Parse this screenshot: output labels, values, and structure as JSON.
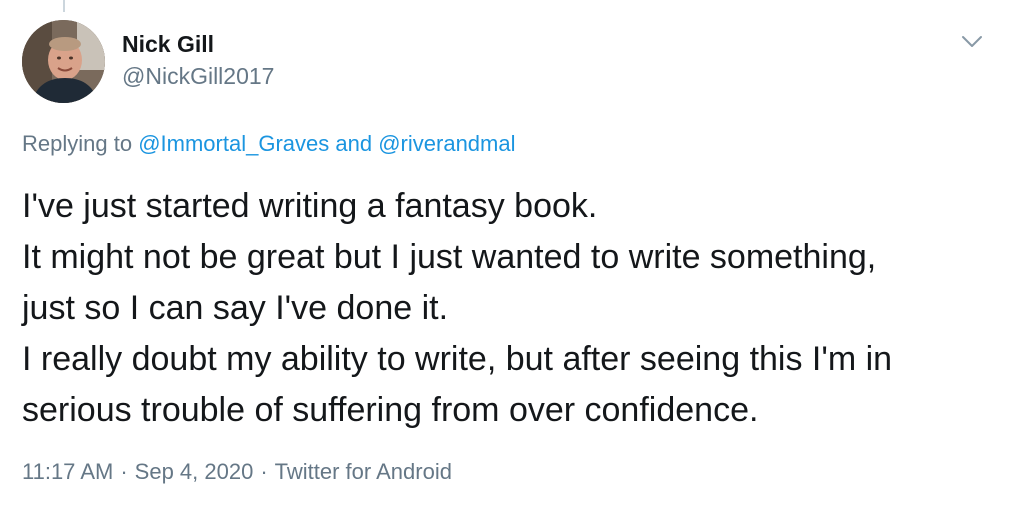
{
  "user": {
    "display_name": "Nick Gill",
    "handle": "@NickGill2017"
  },
  "more_icon": "chevron-down-icon",
  "reply_context": {
    "prefix": "Replying to",
    "mention_1": "@Immortal_Graves",
    "conjunction": "and",
    "mention_2": "@riverandmal"
  },
  "tweet": {
    "lines": [
      "I've just started writing a fantasy book.",
      "It might not be great but I just wanted to write something,",
      "just so I can say I've done it.",
      "I really doubt my ability to write, but after seeing this I'm in",
      "serious trouble of suffering from over confidence."
    ]
  },
  "meta": {
    "time": "11:17 AM",
    "separator": "·",
    "date": "Sep 4, 2020",
    "source": "Twitter for Android"
  },
  "colors": {
    "text": "#14171a",
    "secondary": "#657786",
    "link": "#1b95e0"
  }
}
